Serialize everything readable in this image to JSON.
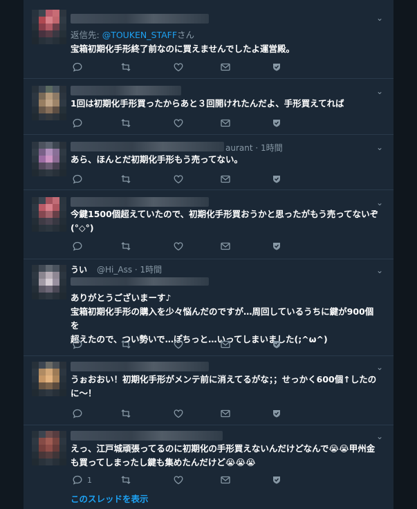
{
  "colors": {
    "background": "#1b2836",
    "text": "#ffffff",
    "muted": "#8899a6",
    "link": "#1da1f2",
    "divider": "#2a3a4b"
  },
  "tweets": [
    {
      "reply_prefix": "返信先: ",
      "reply_handle": "@TOUKEN_STAFF",
      "reply_suffix": "さん",
      "lines": [
        "宝箱初期化手形終了前なのに買えませんでしたよ運営殿。"
      ]
    },
    {
      "lines": [
        "1回は初期化手形買ったからあと３回開けれたんだよ、手形買えてれば"
      ]
    },
    {
      "header_tail": "aurant · 1時間",
      "lines": [
        "あら、ほんとだ初期化手形もう売ってない。"
      ]
    },
    {
      "lines": [
        "今鍵1500個超えていたので、初期化手形買おうかと思ったがもう売ってないぞ",
        "(°◇°)"
      ]
    },
    {
      "header_name": "うい",
      "header_tail": "@Hi_Ass · 1時間",
      "lines": [
        "ありがとうございまーす♪",
        "宝箱初期化手形の購入を少々悩んだのですが…周回しているうちに鍵が900個を",
        "超えたので、つい勢いで…ぽちっと…いってしまいました(;^ω^)"
      ]
    },
    {
      "lines": [
        "うぉおおい！初期化手形がメンテ前に消えてるがな；；せっかく600個↑したの",
        "に〜！"
      ]
    },
    {
      "lines": [
        "えっ、江戸城頑張ってるのに初期化の手形買えないんだけどなんで😭😭甲州金",
        "も買ってしまったし鍵も集めたんだけど😭😭😭"
      ],
      "reply_count": "1",
      "show_thread": "このスレッドを表示"
    }
  ]
}
